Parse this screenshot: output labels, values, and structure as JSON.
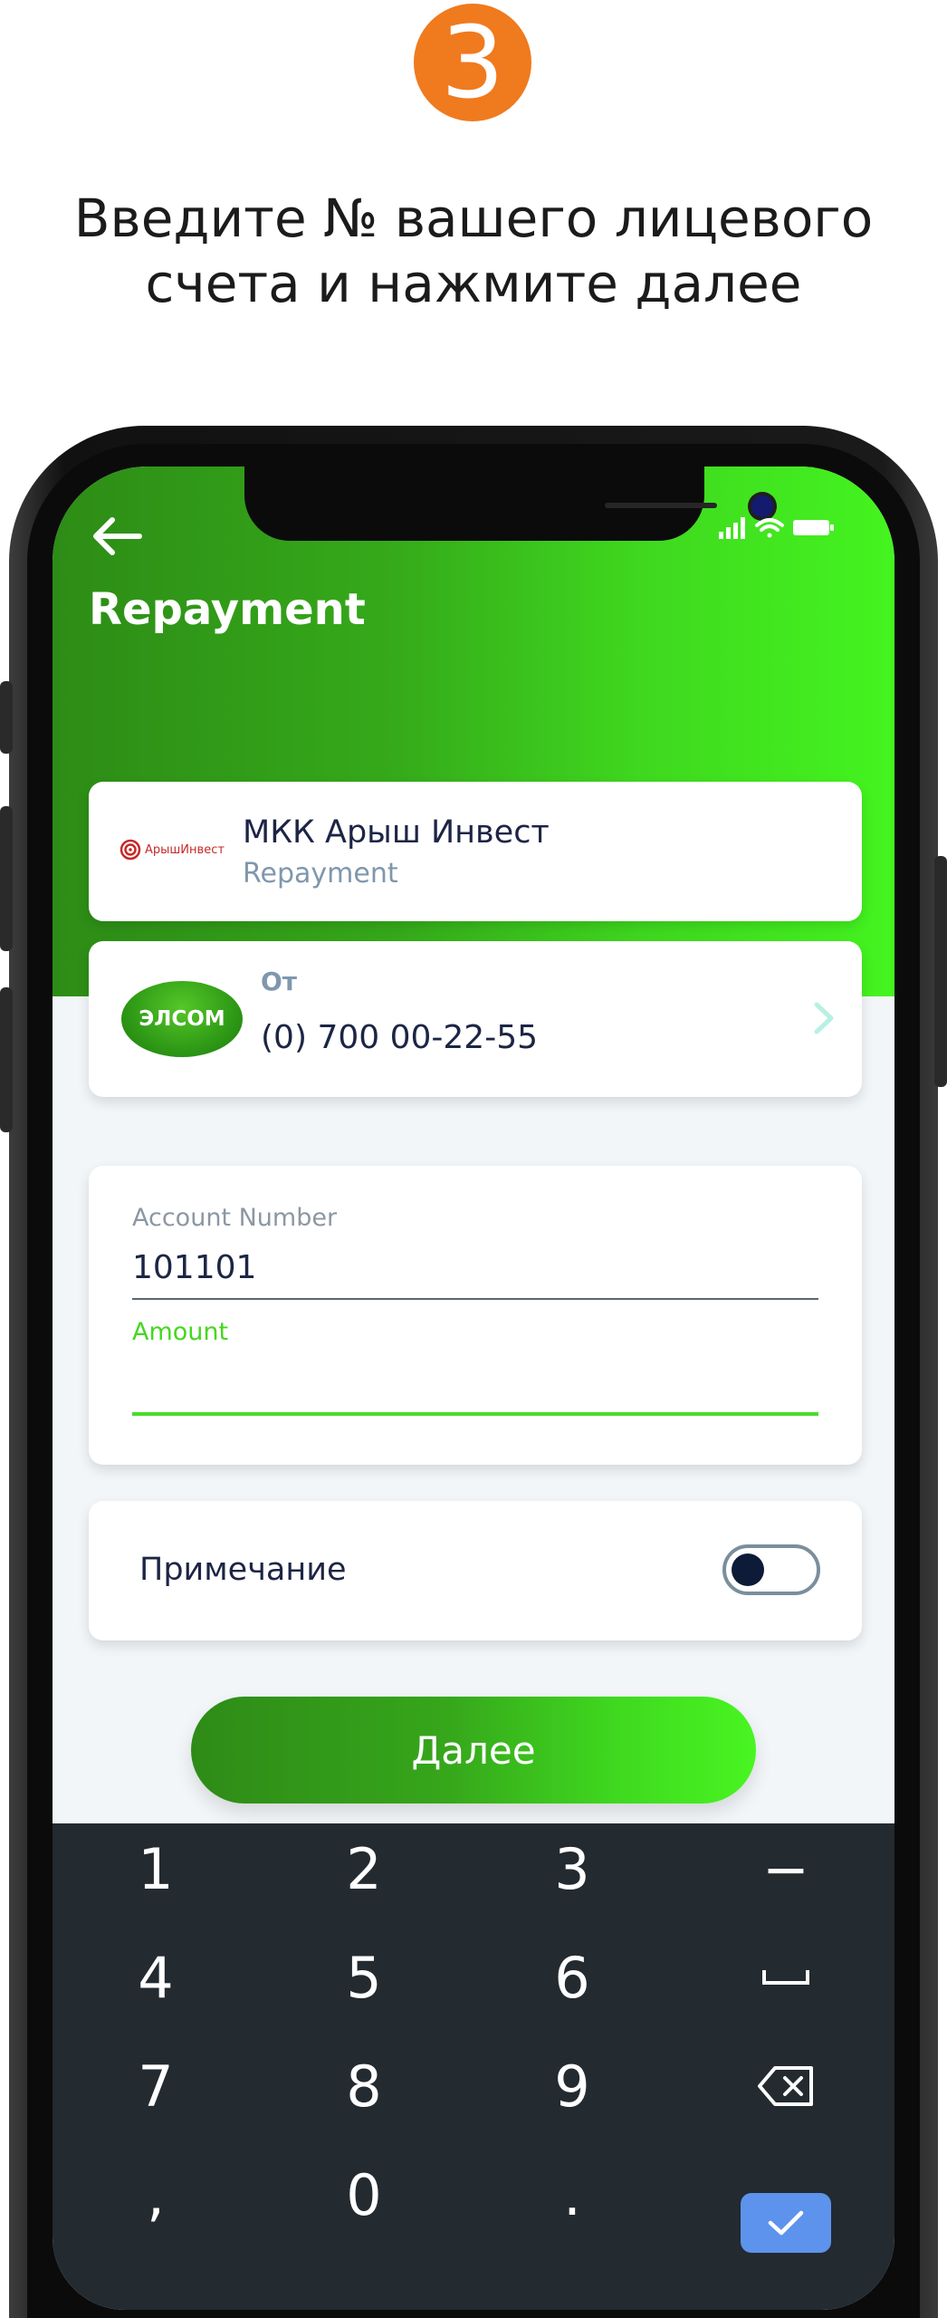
{
  "step": {
    "number": "3"
  },
  "instruction": {
    "line1": "Введите № вашего лицевого",
    "line2": "счета и нажмите далее"
  },
  "header": {
    "title": "Repayment"
  },
  "merchant": {
    "logo_text": "АрышИнвест",
    "name": "МКК Арыш Инвест",
    "subtitle": "Repayment"
  },
  "from": {
    "logo_text": "ЭЛСОМ",
    "label": "От",
    "number": "(0) 700 00-22-55"
  },
  "form": {
    "account_label": "Account Number",
    "account_value": "101101",
    "amount_label": "Amount",
    "amount_value": ""
  },
  "note": {
    "label": "Примечание",
    "toggle_on": false
  },
  "next_button": {
    "label": "Далее"
  },
  "keyboard": {
    "keys": [
      [
        "1",
        "2",
        "3",
        "−"
      ],
      [
        "4",
        "5",
        "6",
        "space"
      ],
      [
        "7",
        "8",
        "9",
        "backspace"
      ],
      [
        ",",
        "0",
        ".",
        "done"
      ]
    ]
  },
  "colors": {
    "badge": "#f07a1e",
    "brand_green": "#44f41f",
    "dark_green": "#2d8c16",
    "keyboard_bg": "#232a30",
    "ok_key": "#5d93ec",
    "text_dark": "#1d2545"
  }
}
